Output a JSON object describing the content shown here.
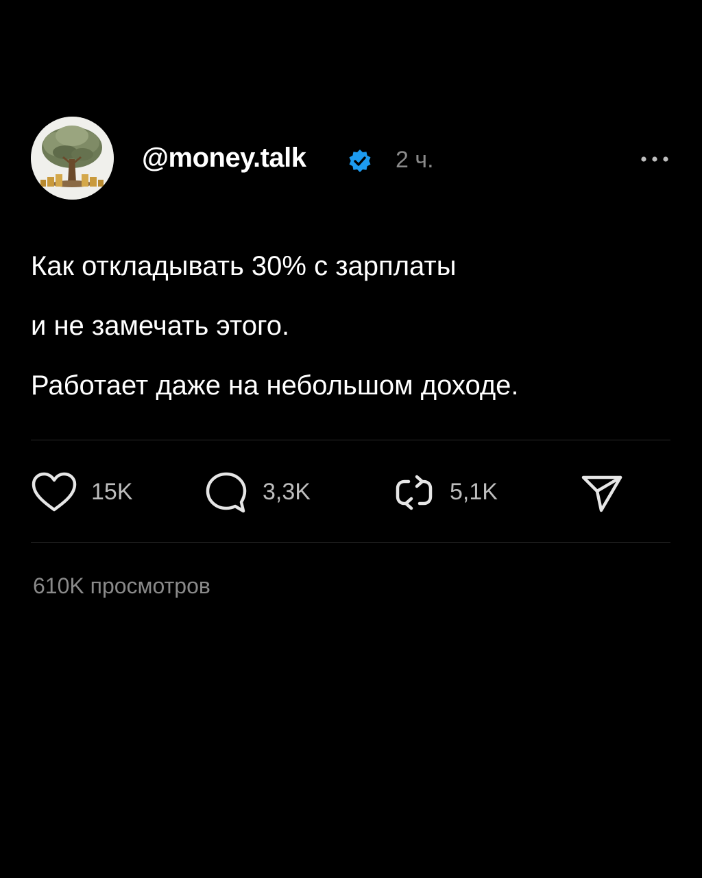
{
  "post": {
    "author": {
      "username": "@money.talk",
      "verified": true,
      "avatar_icon": "money-tree-icon"
    },
    "time": "2 ч.",
    "text_lines": [
      "Как откладывать 30% с зарплаты",
      "и не замечать этого.",
      "Работает даже на небольшом доходе."
    ],
    "actions": {
      "likes": "15K",
      "comments": "3,3K",
      "reposts": "5,1K"
    },
    "views": "610K просмотров"
  },
  "colors": {
    "background": "#000000",
    "text": "#ffffff",
    "muted": "#8a8a8a",
    "verified_badge": "#1d9bf0",
    "divider": "#2a2a2a"
  },
  "icons": {
    "more": "more-dots-icon",
    "like": "heart-icon",
    "comment": "comment-bubble-icon",
    "repost": "repost-icon",
    "share": "send-icon",
    "verified": "verified-badge-icon"
  }
}
